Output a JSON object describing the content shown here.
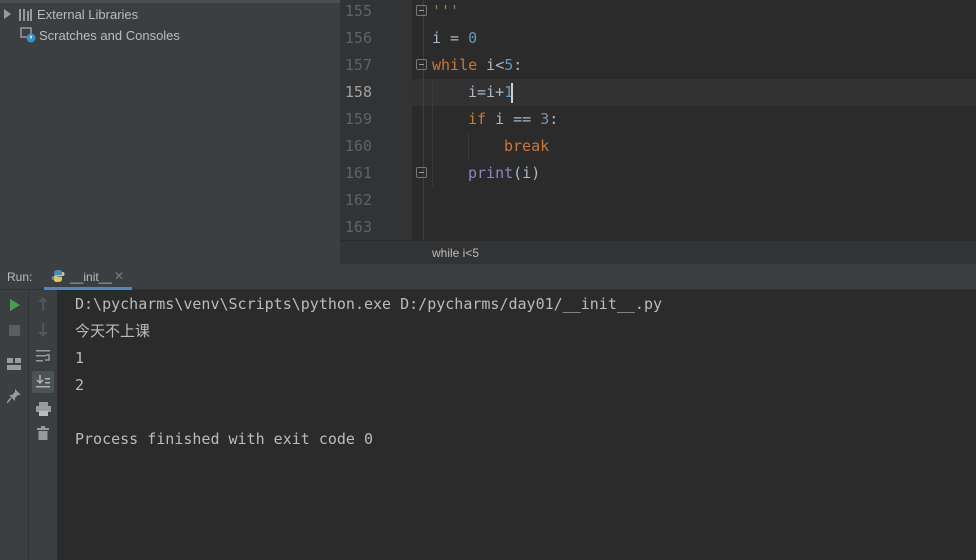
{
  "project_tree": {
    "items": [
      {
        "label": "External Libraries",
        "icon": "library-icon"
      },
      {
        "label": "Scratches and Consoles",
        "icon": "scratches-icon"
      }
    ]
  },
  "editor": {
    "lines": [
      {
        "number": "155"
      },
      {
        "number": "156"
      },
      {
        "number": "157"
      },
      {
        "number": "158"
      },
      {
        "number": "159"
      },
      {
        "number": "160"
      },
      {
        "number": "161"
      },
      {
        "number": "162"
      },
      {
        "number": "163"
      }
    ],
    "code": {
      "l155": "'''",
      "l156_a": "i = ",
      "l156_b": "0",
      "l157_kw": "while",
      "l157_a": " i<",
      "l157_num": "5",
      "l157_b": ":",
      "l158_a": "i=i+",
      "l158_num": "1",
      "l159_kw": "if",
      "l159_a": " i == ",
      "l159_num": "3",
      "l159_b": ":",
      "l160_kw": "break",
      "l161_bi": "print",
      "l161_a": "(i)"
    },
    "current_line": "158",
    "breadcrumb": "while i<5"
  },
  "run_panel": {
    "label": "Run:",
    "tab": "__init__",
    "console": [
      "D:\\pycharms\\venv\\Scripts\\python.exe D:/pycharms/day01/__init__.py",
      "今天不上课",
      "1",
      "2",
      "",
      "Process finished with exit code 0"
    ]
  },
  "colors": {
    "keyword": "#cc7832",
    "number": "#6897bb",
    "builtin": "#8888c6",
    "string": "#629755",
    "run_green": "#499c54",
    "tab_underline": "#4a88c7"
  }
}
